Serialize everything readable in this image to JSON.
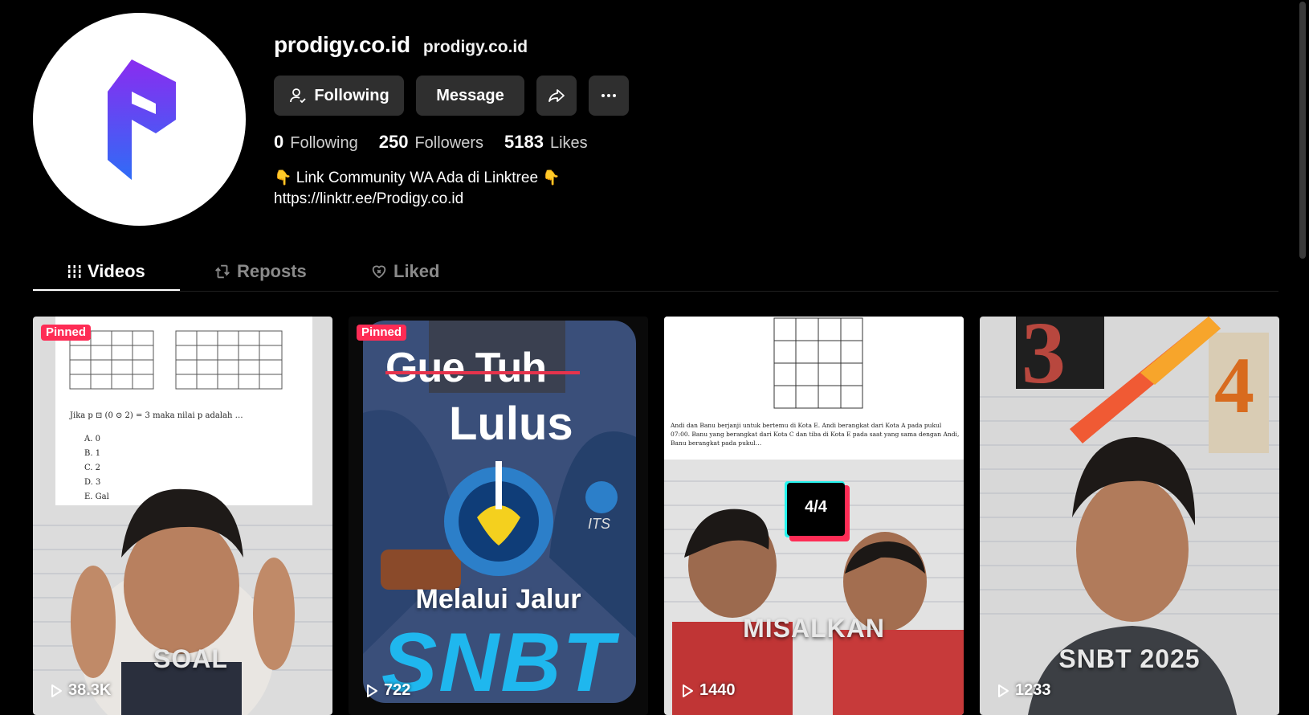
{
  "profile": {
    "username": "prodigy.co.id",
    "nickname": "prodigy.co.id",
    "avatar_icon": "prodigy-logo-icon",
    "brand_color": "#7b2ff7"
  },
  "actions": {
    "following_label": "Following",
    "message_label": "Message",
    "share_icon": "share-icon",
    "more_icon": "more-icon"
  },
  "stats": {
    "following_count": "0",
    "following_label": "Following",
    "followers_count": "250",
    "followers_label": "Followers",
    "likes_count": "5183",
    "likes_label": "Likes"
  },
  "bio": {
    "line1_emoji_left": "👇",
    "line1_text": "Link Community WA Ada di Linktree",
    "line1_emoji_right": "👇",
    "line2": "https://linktr.ee/Prodigy.co.id"
  },
  "tabs": [
    {
      "label": "Videos",
      "icon": "grid-icon",
      "active": true
    },
    {
      "label": "Reposts",
      "icon": "repost-icon",
      "active": false
    },
    {
      "label": "Liked",
      "icon": "heart-icon",
      "active": false
    }
  ],
  "videos": [
    {
      "pinned_label": "Pinned",
      "views": "38.3K",
      "overlay": "SOAL",
      "question": "Jika p ⊡ (0 ⊙ 2) = 3 maka nilai p adalah …",
      "options": [
        "A.  0",
        "B.  1",
        "C.  2",
        "D.  3",
        "E.  Gal"
      ]
    },
    {
      "pinned_label": "Pinned",
      "views": "722",
      "line1": "Gue Tuh",
      "line2": "Lulus",
      "line3": "Melalui Jalur",
      "line4": "SNBT",
      "logo_text": "ITS"
    },
    {
      "views": "1440",
      "counter": "4/4",
      "overlay": "MISALKAN",
      "question": "Andi dan Banu berjanji untuk bertemu di Kota E. Andi berangkat dari Kota A pada pukul 07:00. Banu yang berangkat dari Kota C dan tiba di Kota E pada saat yang sama dengan Andi, Banu berangkat pada pukul…"
    },
    {
      "views": "1233",
      "overlay": "SNBT 2025",
      "num_left": "3",
      "num_right": "4"
    }
  ]
}
